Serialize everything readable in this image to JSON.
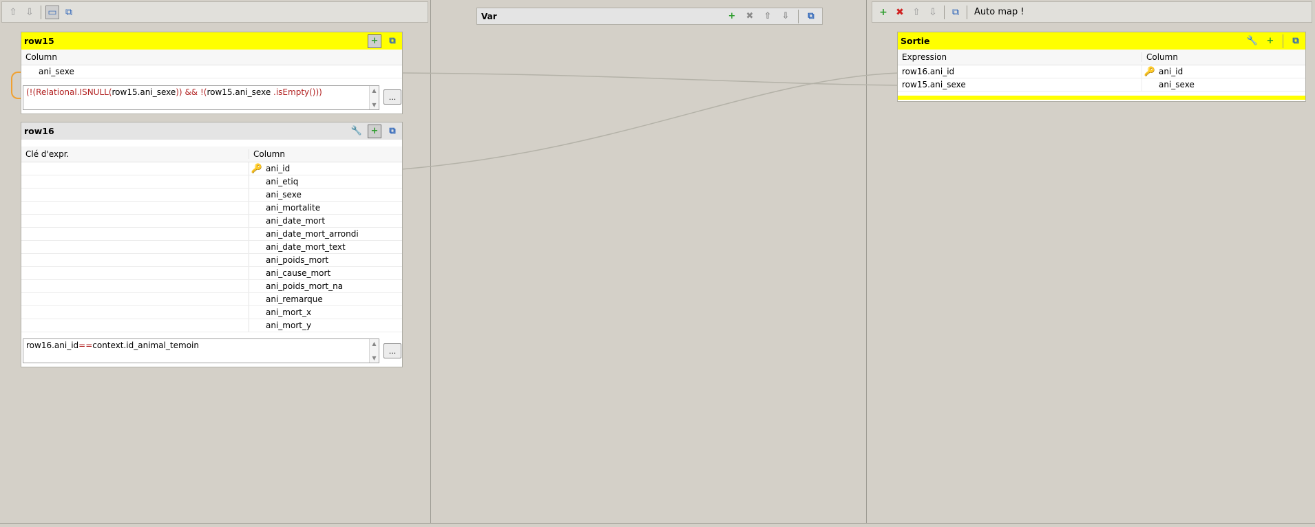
{
  "left_toolbar": {
    "buttons": [
      {
        "icon": "move-up-icon"
      },
      {
        "icon": "move-down-icon"
      },
      {
        "icon": "table-view-icon"
      },
      {
        "icon": "minimize-all-icon"
      }
    ]
  },
  "row15": {
    "title": "row15",
    "column_header": "Column",
    "columns": [
      "ani_sexe"
    ],
    "filter_expression": {
      "part1": "(!(Relational.ISNULL(",
      "part2": "row15.ani_sexe",
      "part3": ")) ",
      "part4": "&& !(",
      "part5": "row15.ani_sexe",
      "part6": " .isEmpty()))"
    },
    "button_label": "..."
  },
  "row16": {
    "title": "row16",
    "header_expr_key": "Clé d'expr.",
    "header_column": "Column",
    "columns": [
      {
        "name": "ani_id",
        "key": true
      },
      {
        "name": "ani_etiq",
        "key": false
      },
      {
        "name": "ani_sexe",
        "key": false
      },
      {
        "name": "ani_mortalite",
        "key": false
      },
      {
        "name": "ani_date_mort",
        "key": false
      },
      {
        "name": "ani_date_mort_arrondi",
        "key": false
      },
      {
        "name": "ani_date_mort_text",
        "key": false
      },
      {
        "name": "ani_poids_mort",
        "key": false
      },
      {
        "name": "ani_cause_mort",
        "key": false
      },
      {
        "name": "ani_poids_mort_na",
        "key": false
      },
      {
        "name": "ani_remarque",
        "key": false
      },
      {
        "name": "ani_mort_x",
        "key": false
      },
      {
        "name": "ani_mort_y",
        "key": false
      }
    ],
    "filter_expression": {
      "part1": "row16.ani_id",
      "part2": "==",
      "part3": "context.id_animal_temoin"
    },
    "button_label": "..."
  },
  "var_panel": {
    "title": "Var"
  },
  "right_toolbar": {
    "auto_map_label": "Auto map !"
  },
  "sortie": {
    "title": "Sortie",
    "header_expression": "Expression",
    "header_column": "Column",
    "rows": [
      {
        "expression": "row16.ani_id",
        "column": "ani_id",
        "key": true
      },
      {
        "expression": "row15.ani_sexe",
        "column": "ani_sexe",
        "key": false
      }
    ]
  },
  "colors": {
    "background": "#d4d0c8",
    "main_table_header": "#ffff00",
    "lookup_header": "#e4e4e4",
    "link_line": "#b4b2a8",
    "expression_keyword": "#b22222"
  }
}
